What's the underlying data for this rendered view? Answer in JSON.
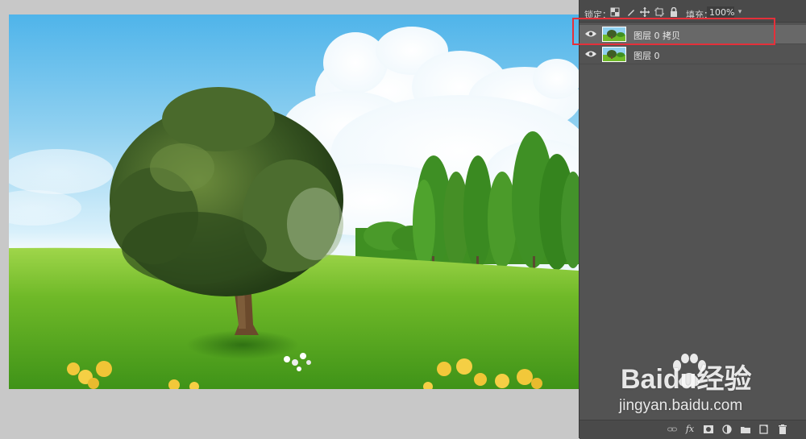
{
  "layers_panel": {
    "lock_label": "锁定：",
    "fill_label": "填充：",
    "fill_value": "100%",
    "layers": [
      {
        "name": "图层 0 拷贝",
        "visible": true,
        "selected": true
      },
      {
        "name": "图层 0",
        "visible": true,
        "selected": false
      }
    ],
    "bottom_icons": [
      "link-icon",
      "fx-icon",
      "mask-icon",
      "adjustment-icon",
      "folder-icon",
      "new-layer-icon",
      "trash-icon"
    ],
    "fx_label": "fx"
  },
  "highlight_color": "#e5303a",
  "watermark": {
    "brand": "Baidu经验",
    "url": "jingyan.baidu.com"
  }
}
